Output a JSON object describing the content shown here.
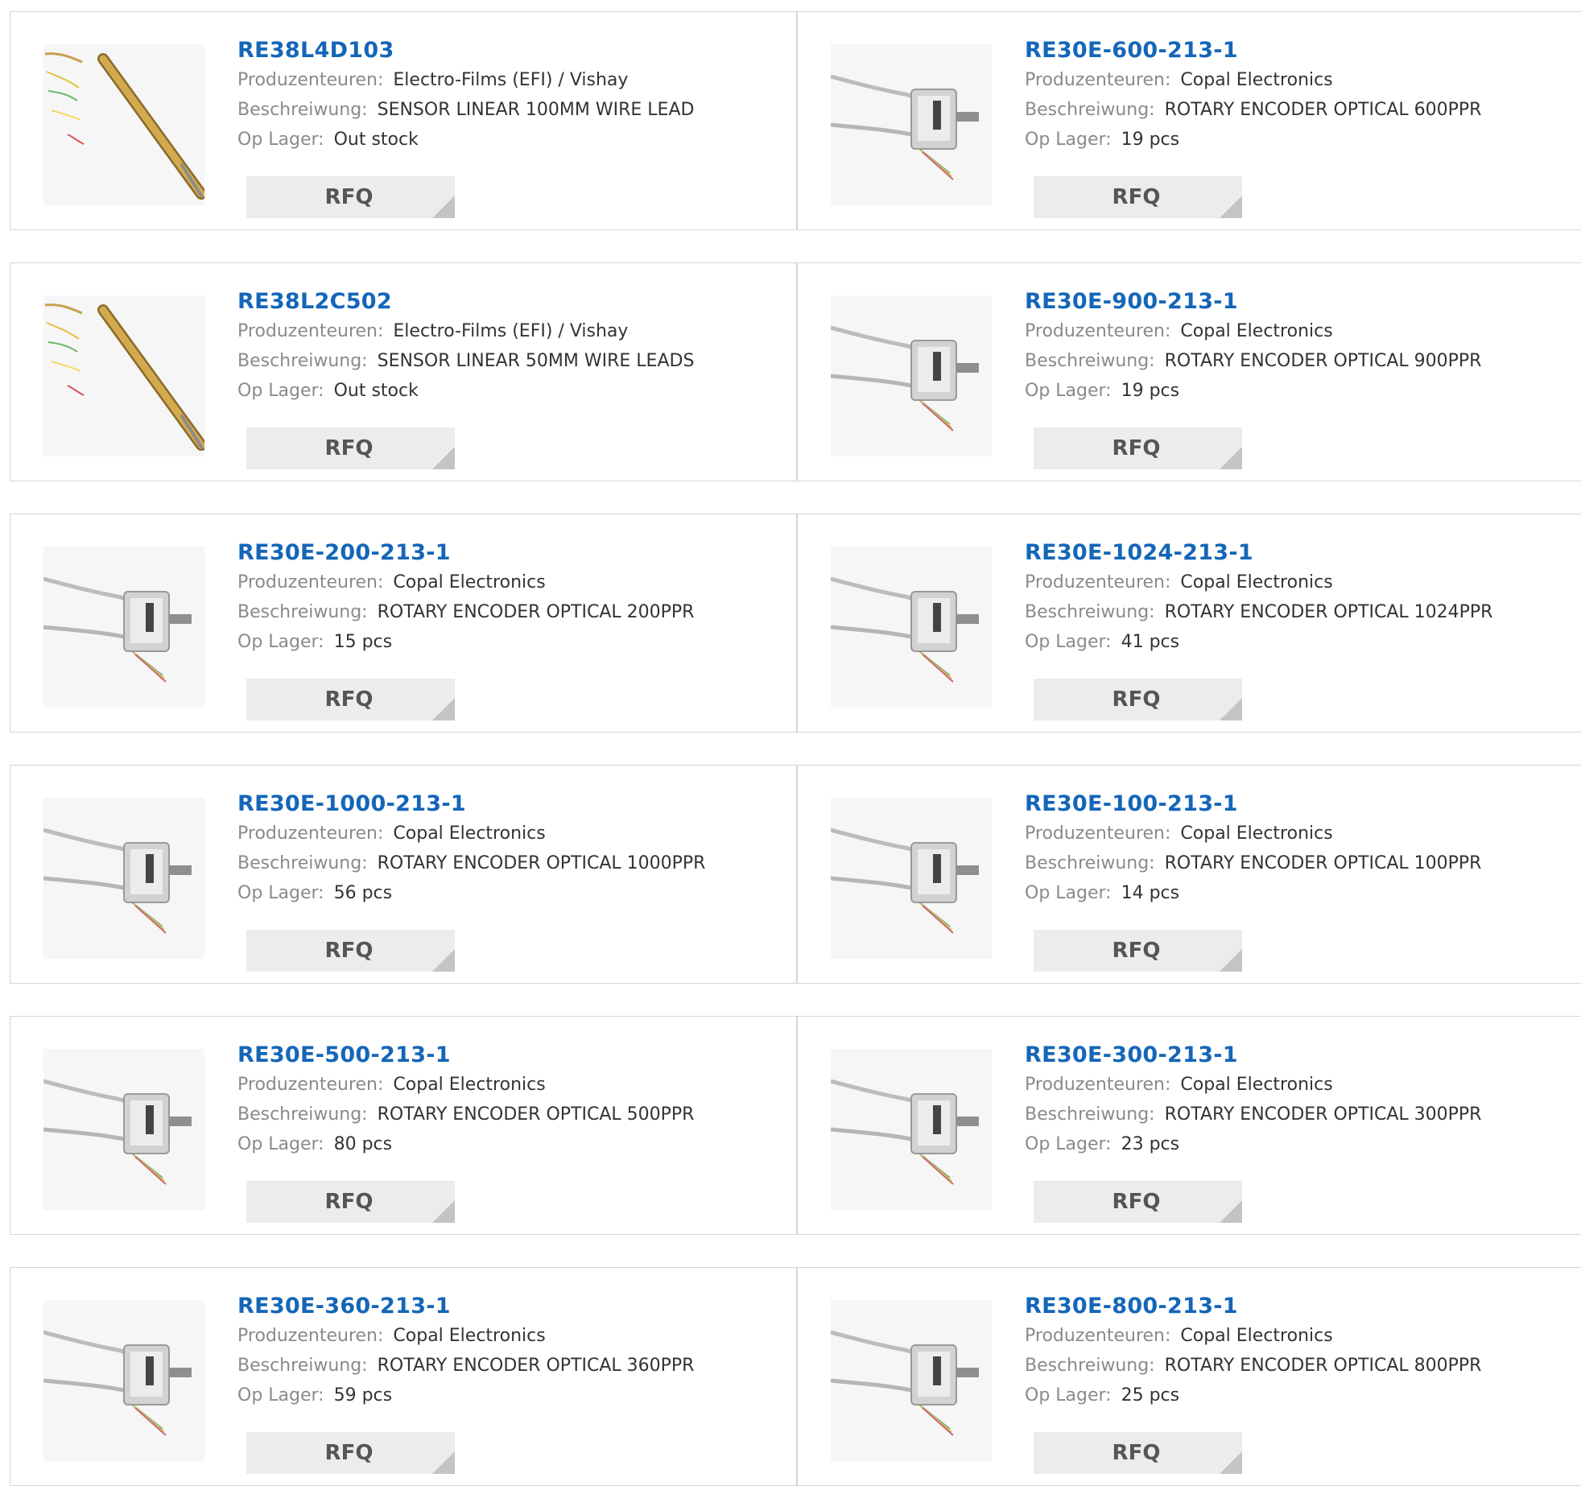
{
  "labels": {
    "manufacturer": "Produzenteuren:",
    "description": "Beschreiwung:",
    "stock": "Op Lager:",
    "rfq": "RFQ"
  },
  "products": [
    {
      "part": "RE38L4D103",
      "manufacturer": "Electro-Films (EFI) / Vishay",
      "description": "SENSOR LINEAR 100MM WIRE LEAD",
      "stock": "Out stock",
      "image": "linear-sensor-image"
    },
    {
      "part": "RE30E-600-213-1",
      "manufacturer": "Copal Electronics",
      "description": "ROTARY ENCODER OPTICAL 600PPR",
      "stock": "19 pcs",
      "image": "rotary-encoder-image"
    },
    {
      "part": "RE38L2C502",
      "manufacturer": "Electro-Films (EFI) / Vishay",
      "description": "SENSOR LINEAR 50MM WIRE LEADS",
      "stock": "Out stock",
      "image": "linear-sensor-image"
    },
    {
      "part": "RE30E-900-213-1",
      "manufacturer": "Copal Electronics",
      "description": "ROTARY ENCODER OPTICAL 900PPR",
      "stock": "19 pcs",
      "image": "rotary-encoder-image"
    },
    {
      "part": "RE30E-200-213-1",
      "manufacturer": "Copal Electronics",
      "description": "ROTARY ENCODER OPTICAL 200PPR",
      "stock": "15 pcs",
      "image": "rotary-encoder-image"
    },
    {
      "part": "RE30E-1024-213-1",
      "manufacturer": "Copal Electronics",
      "description": "ROTARY ENCODER OPTICAL 1024PPR",
      "stock": "41 pcs",
      "image": "rotary-encoder-image"
    },
    {
      "part": "RE30E-1000-213-1",
      "manufacturer": "Copal Electronics",
      "description": "ROTARY ENCODER OPTICAL 1000PPR",
      "stock": "56 pcs",
      "image": "rotary-encoder-image"
    },
    {
      "part": "RE30E-100-213-1",
      "manufacturer": "Copal Electronics",
      "description": "ROTARY ENCODER OPTICAL 100PPR",
      "stock": "14 pcs",
      "image": "rotary-encoder-image"
    },
    {
      "part": "RE30E-500-213-1",
      "manufacturer": "Copal Electronics",
      "description": "ROTARY ENCODER OPTICAL 500PPR",
      "stock": "80 pcs",
      "image": "rotary-encoder-image"
    },
    {
      "part": "RE30E-300-213-1",
      "manufacturer": "Copal Electronics",
      "description": "ROTARY ENCODER OPTICAL 300PPR",
      "stock": "23 pcs",
      "image": "rotary-encoder-image"
    },
    {
      "part": "RE30E-360-213-1",
      "manufacturer": "Copal Electronics",
      "description": "ROTARY ENCODER OPTICAL 360PPR",
      "stock": "59 pcs",
      "image": "rotary-encoder-image"
    },
    {
      "part": "RE30E-800-213-1",
      "manufacturer": "Copal Electronics",
      "description": "ROTARY ENCODER OPTICAL 800PPR",
      "stock": "25 pcs",
      "image": "rotary-encoder-image"
    }
  ]
}
